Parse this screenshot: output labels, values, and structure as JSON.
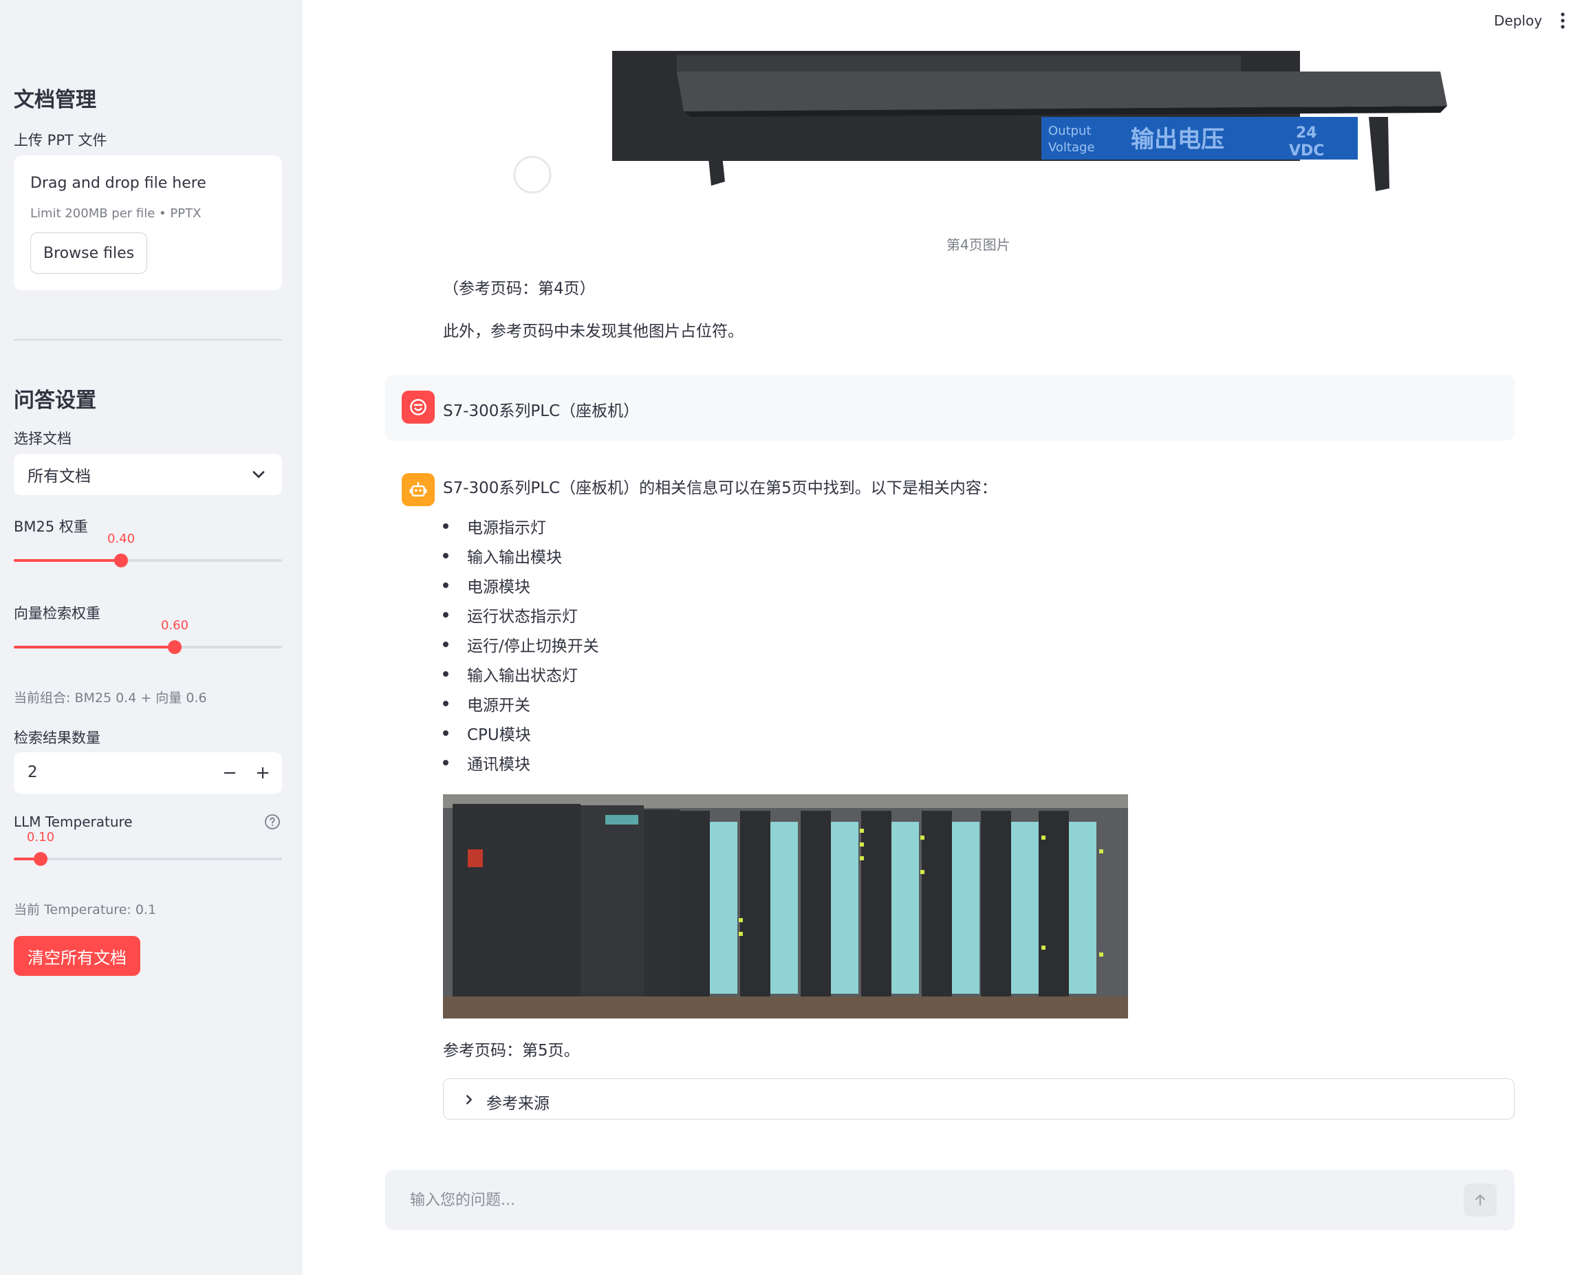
{
  "topbar": {
    "deploy_label": "Deploy",
    "menu_icon": "kebab-icon"
  },
  "sidebar": {
    "doc_section_title": "文档管理",
    "upload_label": "上传 PPT 文件",
    "uploader": {
      "drag_text": "Drag and drop file here",
      "limit_text": "Limit 200MB per file • PPTX",
      "browse_label": "Browse files"
    },
    "qa_section_title": "问答设置",
    "select_doc_label": "选择文档",
    "select_doc_value": "所有文档",
    "bm25_label": "BM25 权重",
    "bm25_value": "0.40",
    "bm25_fraction": 0.4,
    "vector_label": "向量检索权重",
    "vector_value": "0.60",
    "vector_fraction": 0.6,
    "combo_caption": "当前组合: BM25 0.4 + 向量 0.6",
    "topk_label": "检索结果数量",
    "topk_value": "2",
    "temp_label": "LLM Temperature",
    "temp_value": "0.10",
    "temp_fraction": 0.1,
    "temp_caption": "当前 Temperature: 0.1",
    "clear_button": "清空所有文档",
    "accent_color": "#ff4b4b"
  },
  "chat": {
    "prev_image_caption": "第4页图片",
    "prev_ref": "（参考页码：第4页）",
    "prev_note": "此外，参考页码中未发现其他图片占位符。",
    "user_message": "S7-300系列PLC（座板机）",
    "assistant_intro": "S7-300系列PLC（座板机）的相关信息可以在第5页中找到。以下是相关内容：",
    "items": [
      "电源指示灯",
      "输入输出模块",
      "电源模块",
      "运行状态指示灯",
      "运行/停止切换开关",
      "输入输出状态灯",
      "电源开关",
      "CPU模块",
      "通讯模块"
    ],
    "assistant_ref": "参考页码：第5页。",
    "sources_expander": "参考来源",
    "input_placeholder": "输入您的问题..."
  }
}
